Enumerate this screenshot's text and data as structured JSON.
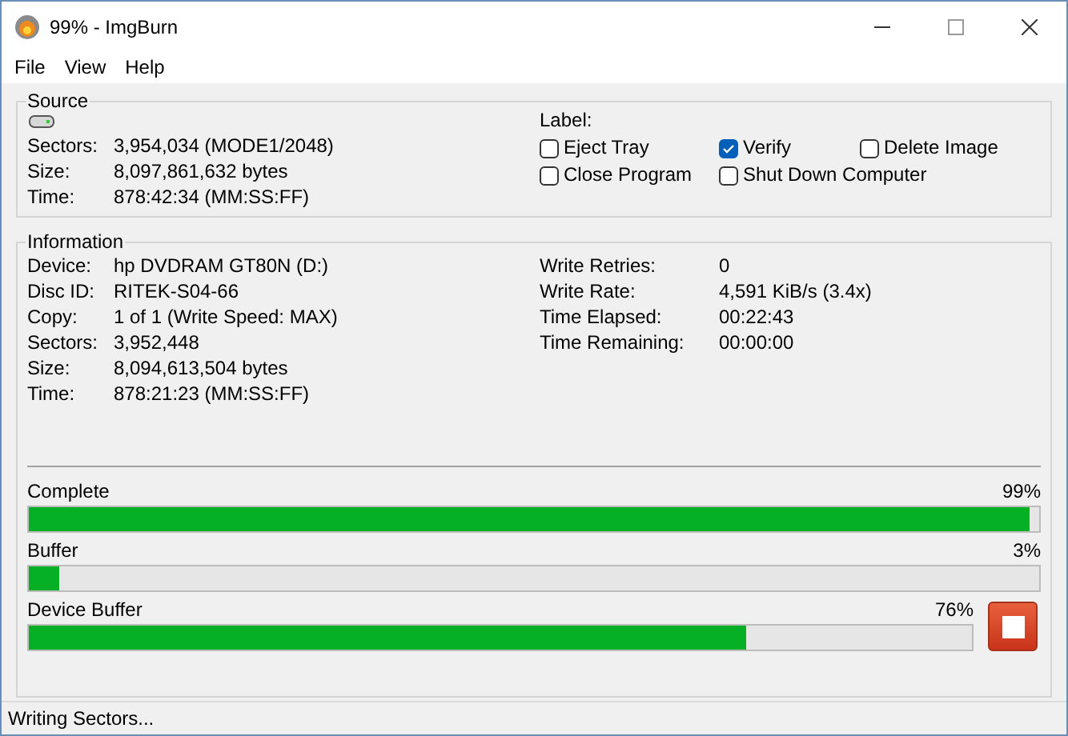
{
  "window": {
    "title": "99% - ImgBurn"
  },
  "menu": [
    "File",
    "View",
    "Help"
  ],
  "source": {
    "title": "Source",
    "rows": [
      {
        "label": "Sectors:",
        "value": "3,954,034 (MODE1/2048)"
      },
      {
        "label": "Size:",
        "value": "8,097,861,632 bytes"
      },
      {
        "label": "Time:",
        "value": "878:42:34 (MM:SS:FF)"
      }
    ],
    "label_caption": "Label:",
    "options": [
      {
        "label": "Eject Tray",
        "checked": false
      },
      {
        "label": "Verify",
        "checked": true
      },
      {
        "label": "Delete Image",
        "checked": false
      },
      {
        "label": "Close Program",
        "checked": false
      },
      {
        "label": "Shut Down Computer",
        "checked": false
      }
    ]
  },
  "information": {
    "title": "Information",
    "left": [
      {
        "label": "Device:",
        "value": "hp DVDRAM GT80N (D:)"
      },
      {
        "label": "Disc ID:",
        "value": "RITEK-S04-66"
      },
      {
        "label": "Copy:",
        "value": "1 of 1 (Write Speed: MAX)"
      },
      {
        "label": "Sectors:",
        "value": "3,952,448"
      },
      {
        "label": "Size:",
        "value": "8,094,613,504 bytes"
      },
      {
        "label": "Time:",
        "value": "878:21:23 (MM:SS:FF)"
      }
    ],
    "right": [
      {
        "label": "Write Retries:",
        "value": "0"
      },
      {
        "label": "Write Rate:",
        "value": "4,591 KiB/s (3.4x)"
      },
      {
        "label": "Time Elapsed:",
        "value": "00:22:43"
      },
      {
        "label": "Time Remaining:",
        "value": "00:00:00"
      }
    ],
    "progress": [
      {
        "name": "Complete",
        "reading": "99%",
        "level": 0.99
      },
      {
        "name": "Buffer",
        "reading": "3%",
        "level": 0.03
      },
      {
        "name": "Device Buffer",
        "reading": "76%",
        "level": 0.76
      }
    ]
  },
  "status_bar": "Writing Sectors..."
}
